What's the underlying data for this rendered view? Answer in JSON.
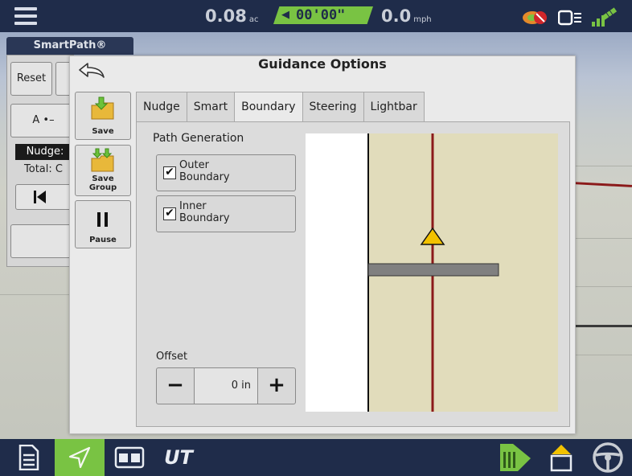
{
  "status_bar": {
    "area_value": "0.08",
    "area_unit": "ac",
    "timer": "00'00\"",
    "speed_value": "0.0",
    "speed_unit": "mph"
  },
  "smartpath": {
    "tab_label": "SmartPath®",
    "reset_label": "Reset",
    "ab_label": "A",
    "nudge_label": "Nudge:",
    "total_label": "Total: C"
  },
  "dialog": {
    "title": "Guidance Options",
    "side_buttons": [
      {
        "label": "Save"
      },
      {
        "label": "Save Group"
      },
      {
        "label": "Pause"
      }
    ],
    "tabs": [
      {
        "label": "Nudge",
        "active": false
      },
      {
        "label": "Smart",
        "active": false
      },
      {
        "label": "Boundary",
        "active": true
      },
      {
        "label": "Steering",
        "active": false
      },
      {
        "label": "Lightbar",
        "active": false
      }
    ],
    "path_generation": {
      "legend": "Path Generation",
      "options": [
        {
          "label_line1": "Outer",
          "label_line2": "Boundary",
          "checked": true
        },
        {
          "label_line1": "Inner",
          "label_line2": "Boundary",
          "checked": true
        }
      ]
    },
    "offset": {
      "label": "Offset",
      "value": "0 in",
      "minus": "−",
      "plus": "+"
    }
  },
  "colors": {
    "accent_green": "#79c343",
    "bar_navy": "#1f2c4a",
    "field_tan": "#e1dcbb",
    "boundary_red": "#8b1a1a",
    "vehicle_yellow": "#f2c200"
  },
  "bottom_nav": {
    "ut_label": "UT"
  }
}
